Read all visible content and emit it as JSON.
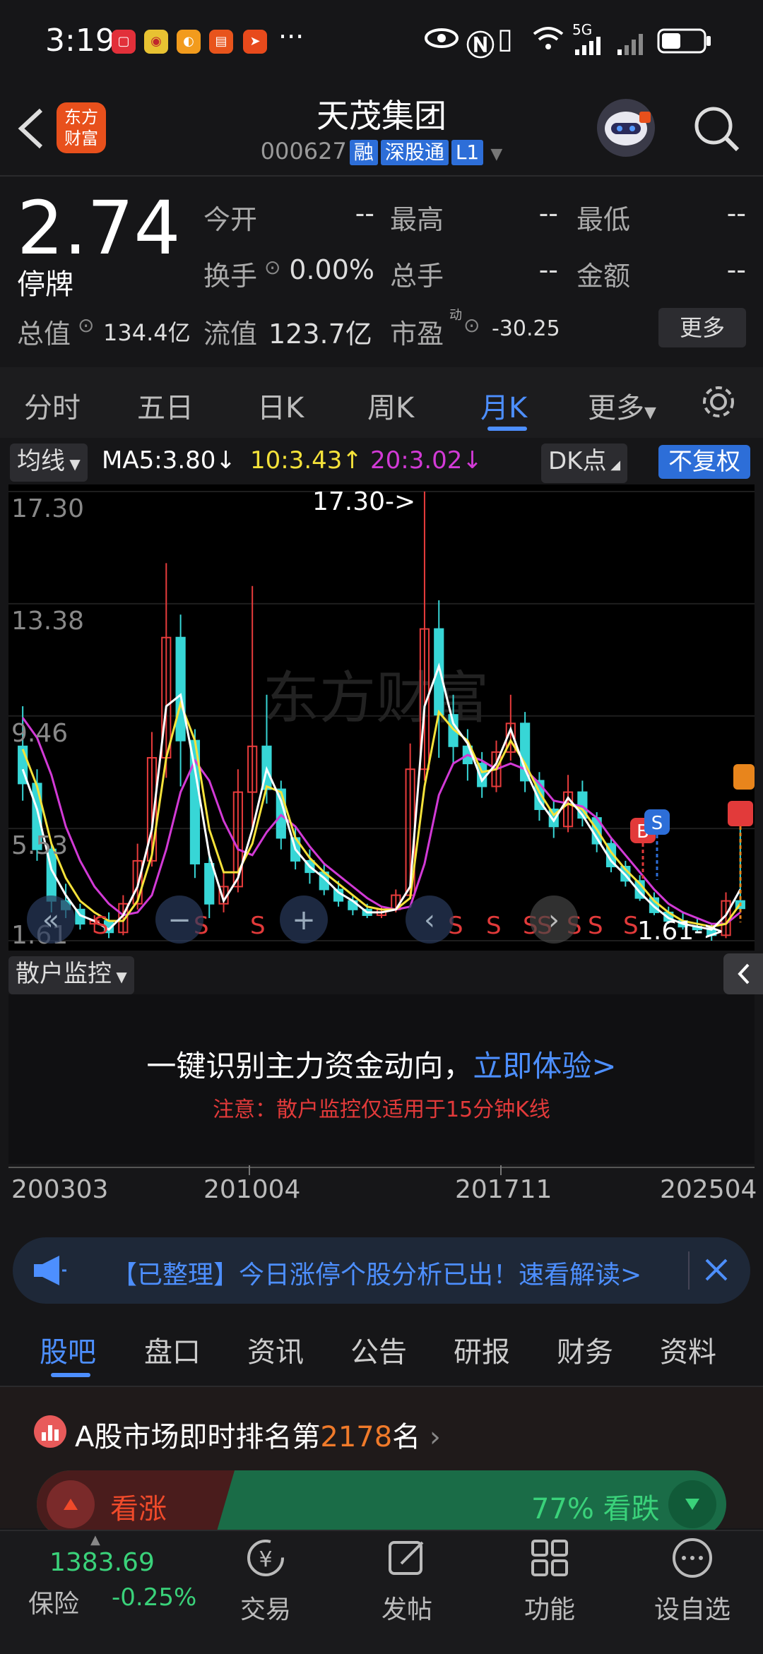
{
  "status_bar": {
    "time": "3:19",
    "network": "5G",
    "more": "···"
  },
  "header": {
    "back_icon": "chevron-left-icon",
    "logo_line1": "东方",
    "logo_line2": "财富",
    "title": "天茂集团",
    "code": "000627",
    "tags": [
      "融",
      "深股通",
      "L1"
    ]
  },
  "quote": {
    "price": "2.74",
    "status": "停牌",
    "open_label": "今开",
    "open_value": "--",
    "high_label": "最高",
    "high_value": "--",
    "low_label": "最低",
    "low_value": "--",
    "turnover_label": "换手",
    "turnover_value": "0.00%",
    "volume_label": "总手",
    "volume_value": "--",
    "amount_label": "金额",
    "amount_value": "--",
    "mktcap_label": "总值",
    "mktcap_value": "134.4亿",
    "float_label": "流值",
    "float_value": "123.7亿",
    "pe_label": "市盈",
    "pe_sup": "动",
    "pe_value": "-30.25",
    "more_button": "更多"
  },
  "tabs": [
    {
      "label": "分时"
    },
    {
      "label": "五日"
    },
    {
      "label": "日K"
    },
    {
      "label": "周K"
    },
    {
      "label": "月K"
    },
    {
      "label": "更多"
    }
  ],
  "toolbar": {
    "ma_select": "均线",
    "ma5": "MA5:3.80↓",
    "ma10": "10:3.43↑",
    "ma20": "20:3.02↓",
    "dk": "DK点",
    "adjust": "不复权"
  },
  "chart_data": {
    "type": "candlestick",
    "y_ticks": [
      "17.30",
      "13.38",
      "9.46",
      "5.53",
      "1.61"
    ],
    "ylim": [
      1.61,
      17.3
    ],
    "max_label": "17.30->",
    "min_label": "1.61->",
    "x_ticks": [
      "200303",
      "201004",
      "201711",
      "202504"
    ],
    "watermark": "东方财富",
    "signal_letters": [
      "S",
      "S",
      "S",
      "S",
      "S",
      "S",
      "S",
      "S",
      "S",
      "S"
    ],
    "colors": {
      "ma5": "#ffffff",
      "ma10": "#f5e23a",
      "ma20": "#d23ad6",
      "up": "#e83c3c",
      "down": "#37d6d6"
    },
    "ma5": [
      7.6,
      6.2,
      4.1,
      3.2,
      2.5,
      2.3,
      2.0,
      2.5,
      3.5,
      5.5,
      9.8,
      10.2,
      7.6,
      4.6,
      3.0,
      3.8,
      5.5,
      7.6,
      6.5,
      4.8,
      4.2,
      3.8,
      3.3,
      3.0,
      2.6,
      2.6,
      2.7,
      3.5,
      9.8,
      11.2,
      9.2,
      8.5,
      7.2,
      7.8,
      9.0,
      7.6,
      6.5,
      5.8,
      6.6,
      6.0,
      5.2,
      4.4,
      3.9,
      3.3,
      2.8,
      2.4,
      2.2,
      2.1,
      2.0,
      2.5,
      3.4
    ],
    "ma10": [
      8.3,
      7.0,
      5.0,
      3.8,
      3.0,
      2.6,
      2.3,
      2.3,
      3.0,
      4.6,
      8.0,
      9.9,
      8.6,
      5.5,
      4.0,
      4.0,
      5.0,
      7.0,
      6.8,
      5.2,
      4.5,
      4.0,
      3.6,
      3.2,
      2.8,
      2.7,
      2.7,
      3.1,
      7.0,
      9.6,
      9.0,
      8.6,
      7.5,
      7.6,
      8.6,
      7.8,
      6.8,
      6.0,
      6.4,
      6.2,
      5.5,
      4.7,
      4.1,
      3.6,
      3.0,
      2.6,
      2.3,
      2.2,
      2.1,
      2.2,
      2.9
    ],
    "ma20": [
      9.4,
      8.7,
      7.4,
      5.6,
      4.4,
      3.5,
      2.9,
      2.5,
      2.6,
      3.2,
      4.8,
      6.8,
      7.9,
      7.2,
      5.8,
      4.8,
      4.6,
      5.4,
      6.0,
      5.6,
      4.9,
      4.3,
      3.9,
      3.5,
      3.1,
      2.8,
      2.7,
      2.8,
      4.3,
      6.7,
      7.8,
      8.1,
      7.9,
      7.6,
      7.8,
      7.6,
      7.1,
      6.5,
      6.4,
      6.3,
      5.9,
      5.2,
      4.6,
      4.0,
      3.4,
      2.9,
      2.6,
      2.4,
      2.2,
      2.2,
      2.6
    ],
    "candles": [
      {
        "o": 8.4,
        "h": 9.8,
        "l": 6.5,
        "c": 7.1
      },
      {
        "o": 7.1,
        "h": 7.6,
        "l": 4.4,
        "c": 4.8
      },
      {
        "o": 4.8,
        "h": 5.0,
        "l": 2.6,
        "c": 3.0
      },
      {
        "o": 3.0,
        "h": 3.6,
        "l": 2.4,
        "c": 2.7
      },
      {
        "o": 2.7,
        "h": 2.9,
        "l": 2.0,
        "c": 2.2
      },
      {
        "o": 2.2,
        "h": 2.5,
        "l": 1.9,
        "c": 2.3
      },
      {
        "o": 2.3,
        "h": 2.6,
        "l": 1.7,
        "c": 1.9
      },
      {
        "o": 1.9,
        "h": 3.2,
        "l": 1.8,
        "c": 2.9
      },
      {
        "o": 2.9,
        "h": 5.0,
        "l": 2.7,
        "c": 4.4
      },
      {
        "o": 4.4,
        "h": 8.9,
        "l": 4.2,
        "c": 8.0
      },
      {
        "o": 8.0,
        "h": 14.8,
        "l": 7.3,
        "c": 12.2
      },
      {
        "o": 12.2,
        "h": 13.0,
        "l": 7.0,
        "c": 8.6
      },
      {
        "o": 8.6,
        "h": 9.0,
        "l": 3.8,
        "c": 4.3
      },
      {
        "o": 4.3,
        "h": 4.6,
        "l": 2.4,
        "c": 2.9
      },
      {
        "o": 2.9,
        "h": 4.0,
        "l": 2.6,
        "c": 3.5
      },
      {
        "o": 3.5,
        "h": 7.6,
        "l": 3.3,
        "c": 6.8
      },
      {
        "o": 6.8,
        "h": 14.0,
        "l": 5.5,
        "c": 8.4
      },
      {
        "o": 8.4,
        "h": 10.2,
        "l": 6.4,
        "c": 6.9
      },
      {
        "o": 6.9,
        "h": 7.2,
        "l": 4.8,
        "c": 5.2
      },
      {
        "o": 5.2,
        "h": 5.6,
        "l": 4.1,
        "c": 4.4
      },
      {
        "o": 4.4,
        "h": 4.8,
        "l": 3.6,
        "c": 4.0
      },
      {
        "o": 4.0,
        "h": 4.3,
        "l": 3.2,
        "c": 3.4
      },
      {
        "o": 3.4,
        "h": 3.7,
        "l": 2.8,
        "c": 3.0
      },
      {
        "o": 3.0,
        "h": 3.2,
        "l": 2.5,
        "c": 2.7
      },
      {
        "o": 2.7,
        "h": 2.9,
        "l": 2.4,
        "c": 2.5
      },
      {
        "o": 2.5,
        "h": 2.8,
        "l": 2.4,
        "c": 2.7
      },
      {
        "o": 2.7,
        "h": 3.4,
        "l": 2.6,
        "c": 3.2
      },
      {
        "o": 3.2,
        "h": 8.5,
        "l": 3.1,
        "c": 7.6
      },
      {
        "o": 7.6,
        "h": 17.3,
        "l": 7.2,
        "c": 12.5
      },
      {
        "o": 12.5,
        "h": 13.5,
        "l": 8.0,
        "c": 9.5
      },
      {
        "o": 9.5,
        "h": 10.2,
        "l": 7.8,
        "c": 8.4
      },
      {
        "o": 8.4,
        "h": 9.0,
        "l": 7.2,
        "c": 7.8
      },
      {
        "o": 7.8,
        "h": 8.2,
        "l": 6.6,
        "c": 7.0
      },
      {
        "o": 7.0,
        "h": 8.6,
        "l": 6.8,
        "c": 8.2
      },
      {
        "o": 8.2,
        "h": 10.2,
        "l": 7.9,
        "c": 9.2
      },
      {
        "o": 9.2,
        "h": 9.6,
        "l": 6.8,
        "c": 7.2
      },
      {
        "o": 7.2,
        "h": 7.5,
        "l": 5.8,
        "c": 6.2
      },
      {
        "o": 6.2,
        "h": 6.5,
        "l": 5.2,
        "c": 5.6
      },
      {
        "o": 5.6,
        "h": 7.4,
        "l": 5.4,
        "c": 6.8
      },
      {
        "o": 6.8,
        "h": 7.2,
        "l": 5.6,
        "c": 5.9
      },
      {
        "o": 5.9,
        "h": 6.1,
        "l": 4.7,
        "c": 5.0
      },
      {
        "o": 5.0,
        "h": 5.2,
        "l": 4.0,
        "c": 4.2
      },
      {
        "o": 4.2,
        "h": 4.4,
        "l": 3.5,
        "c": 3.7
      },
      {
        "o": 3.7,
        "h": 3.9,
        "l": 3.0,
        "c": 3.1
      },
      {
        "o": 3.1,
        "h": 3.3,
        "l": 2.5,
        "c": 2.6
      },
      {
        "o": 2.6,
        "h": 2.8,
        "l": 2.2,
        "c": 2.3
      },
      {
        "o": 2.3,
        "h": 2.6,
        "l": 2.0,
        "c": 2.1
      },
      {
        "o": 2.1,
        "h": 2.4,
        "l": 1.9,
        "c": 2.0
      },
      {
        "o": 2.0,
        "h": 2.2,
        "l": 1.61,
        "c": 1.8
      },
      {
        "o": 1.8,
        "h": 3.3,
        "l": 1.7,
        "c": 3.0
      },
      {
        "o": 3.0,
        "h": 5.6,
        "l": 2.7,
        "c": 2.74
      }
    ]
  },
  "monitor": {
    "label": "散户监控",
    "headline": "一键识别主力资金动向，",
    "cta": "立即体验>",
    "note": "注意：散户监控仅适用于15分钟K线"
  },
  "banner": {
    "text": "【已整理】今日涨停个股分析已出！速看解读>"
  },
  "bottom_tabs": [
    {
      "label": "股吧"
    },
    {
      "label": "盘口"
    },
    {
      "label": "资讯"
    },
    {
      "label": "公告"
    },
    {
      "label": "研报"
    },
    {
      "label": "财务"
    },
    {
      "label": "资料"
    }
  ],
  "rank": {
    "prefix": "A股市场即时排名第",
    "number": "2178",
    "suffix": "名"
  },
  "vote": {
    "bull_label": "看涨",
    "bear_label": "77% 看跌"
  },
  "nav": {
    "index_value": "1383.69",
    "index_name": "保险",
    "index_change": "-0.25%",
    "items": [
      {
        "label": "交易"
      },
      {
        "label": "发帖"
      },
      {
        "label": "功能"
      },
      {
        "label": "设自选"
      }
    ]
  }
}
